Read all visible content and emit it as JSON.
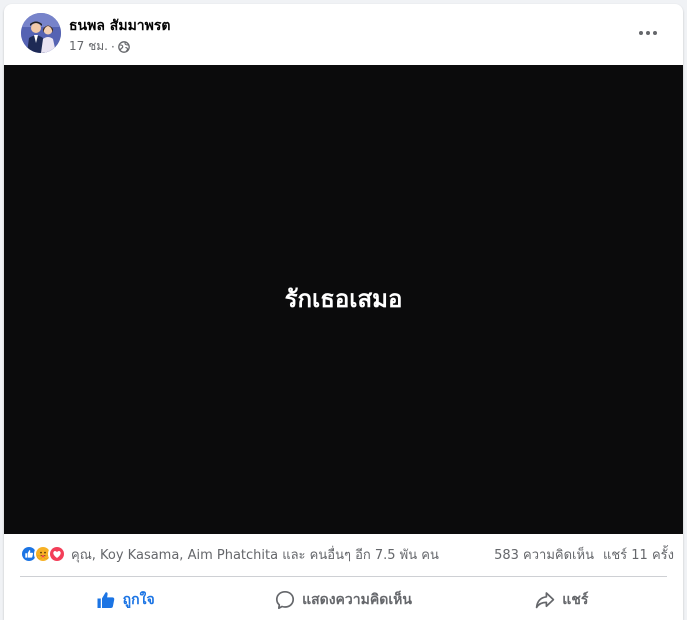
{
  "post": {
    "author": "ธนพล สัมมาพรต",
    "time": "17 ชม.",
    "separator": "·",
    "media_text": "รักเธอเสมอ",
    "reactors": "คุณ, Koy Kasama, Aim Phatchita และ คนอื่นๆ อีก 7.5 พัน คน",
    "comments_count": "583 ความคิดเห็น",
    "shares_count": "แชร์ 11 ครั้ง",
    "reaction_types": [
      "like",
      "care",
      "love"
    ],
    "audience_icon": "globe-icon"
  },
  "actions": {
    "like_label": "ถูกใจ",
    "comment_label": "แสดงความคิดเห็น",
    "share_label": "แชร์"
  },
  "colors": {
    "like_blue": "#1b74e4",
    "love_red": "#f33e58",
    "care_yellow": "#f7b125",
    "secondary_text": "#65676b",
    "media_background": "#0b0b0c"
  }
}
